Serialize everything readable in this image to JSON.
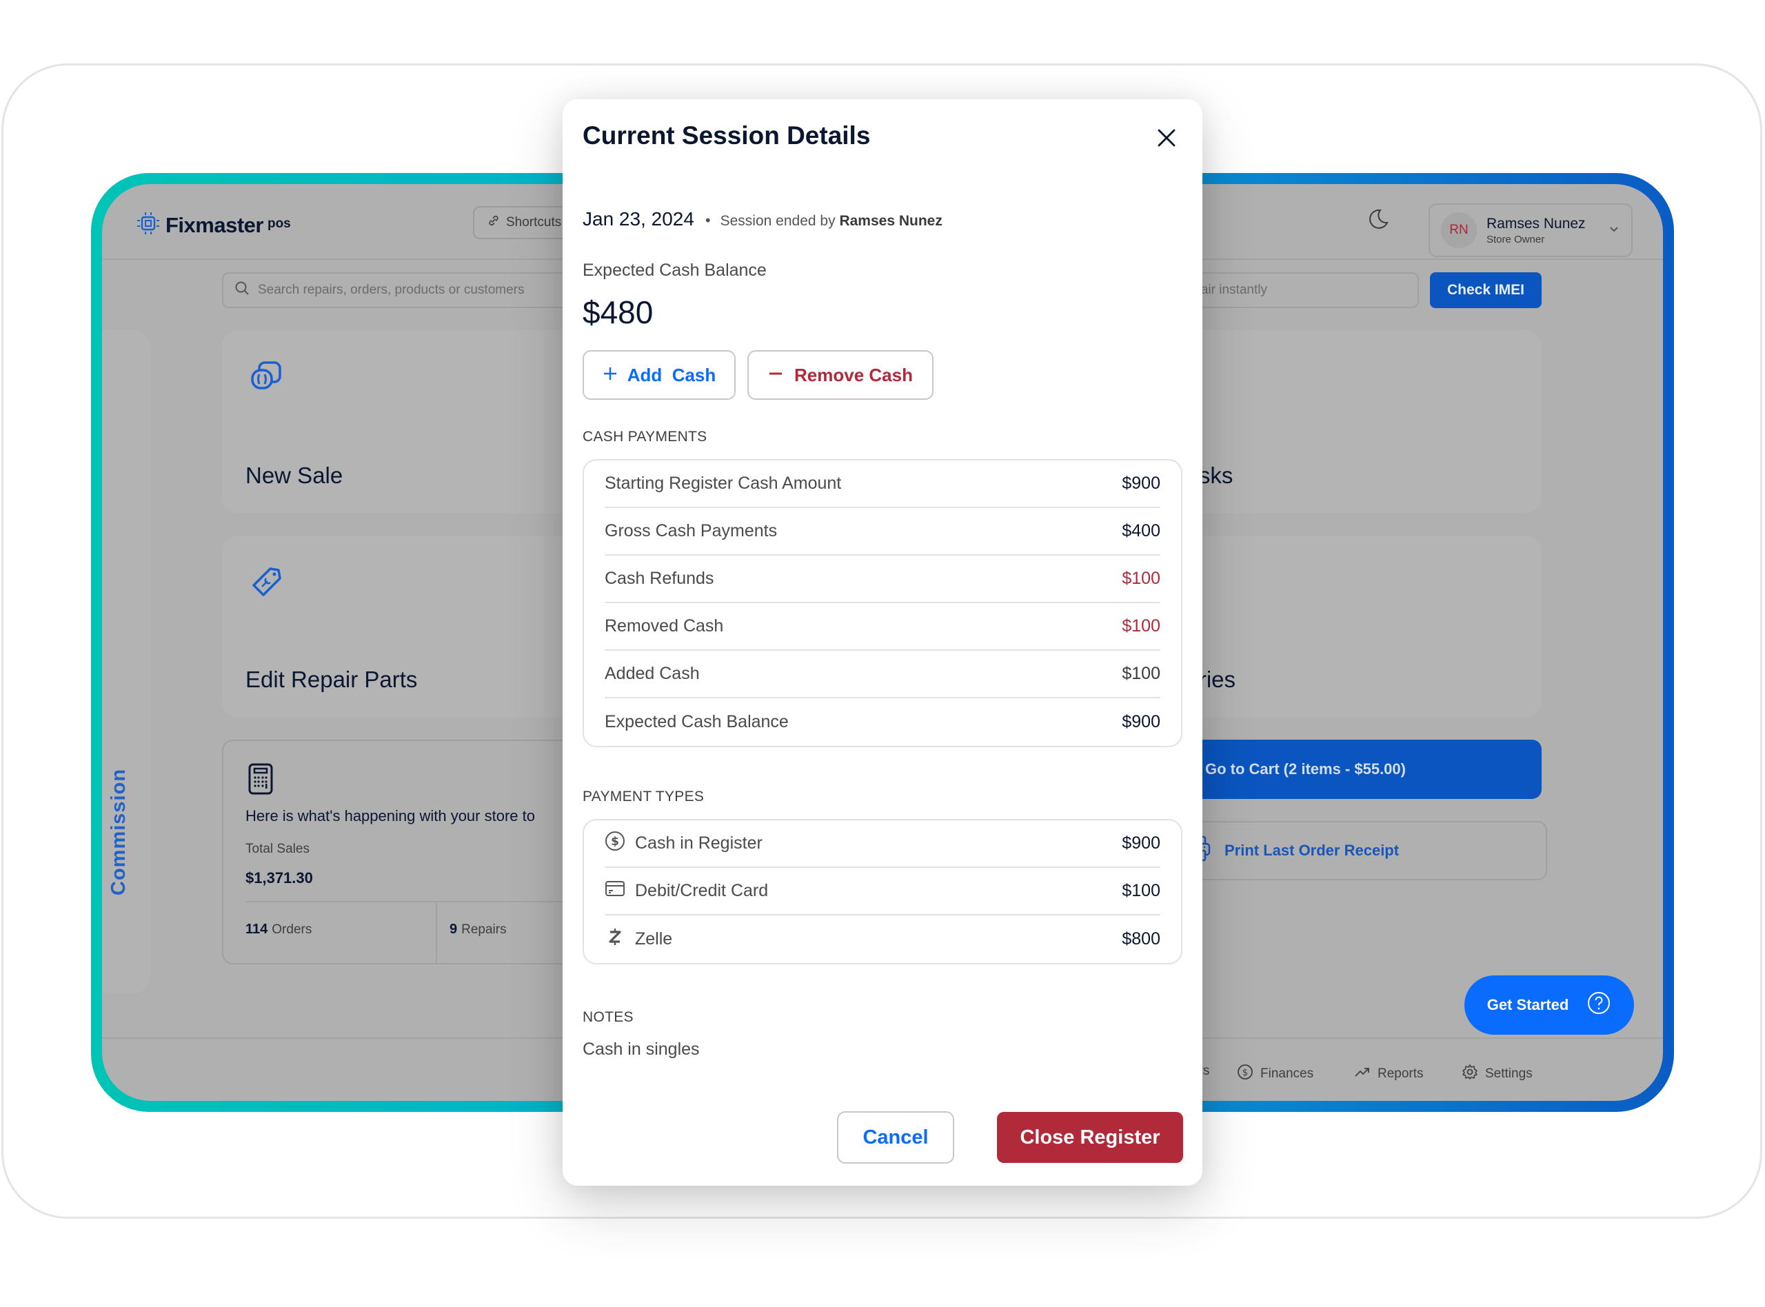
{
  "app": {
    "logo_text": "Fixmaster",
    "logo_suffix": "pos",
    "shortcuts_label": "Shortcuts",
    "user": {
      "initials": "RN",
      "name": "Ramses Nunez",
      "role": "Store Owner"
    },
    "search_placeholder": "Search repairs, orders, products or customers",
    "imei_placeholder": "f a repair instantly",
    "check_imei_label": "Check IMEI",
    "sidebar_tab_label": "Commission",
    "cards": {
      "new_sale": "New Sale",
      "edit_repair_parts": "Edit Repair Parts",
      "tasks": "Tasks",
      "accessories": "sories"
    },
    "stats": {
      "headline": "Here is what's happening with your store to",
      "total_sales_label": "Total Sales",
      "total_sales_value": "$1,371.30",
      "orders_count": "114",
      "orders_label": "Orders",
      "repairs_count": "9",
      "repairs_label": "Repairs"
    },
    "cart_button": "Go to Cart (2 items - $55.00)",
    "print_button": "Print Last Order Receipt",
    "get_started_button": "Get Started",
    "bottom_nav": [
      {
        "label": "ers",
        "icon": "users-icon"
      },
      {
        "label": "Finances",
        "icon": "dollar-circle-icon"
      },
      {
        "label": "Reports",
        "icon": "trend-up-icon"
      },
      {
        "label": "Settings",
        "icon": "gear-icon"
      }
    ]
  },
  "modal": {
    "title": "Current Session Details",
    "date": "Jan 23, 2024",
    "session_ended_prefix": "Session ended by",
    "session_ended_by": "Ramses Nunez",
    "expected_cash_balance_label": "Expected Cash Balance",
    "expected_cash_balance_value": "$480",
    "add_cash_label": "Add  Cash",
    "remove_cash_label": "Remove Cash",
    "cash_payments": {
      "label": "CASH PAYMENTS",
      "rows": [
        {
          "label": "Starting Register Cash Amount",
          "value": "$900",
          "tone": "normal"
        },
        {
          "label": "Gross Cash Payments",
          "value": "$400",
          "tone": "normal"
        },
        {
          "label": "Cash Refunds",
          "value": "$100",
          "tone": "negative"
        },
        {
          "label": "Removed Cash",
          "value": "$100",
          "tone": "negative"
        },
        {
          "label": "Added Cash",
          "value": "$100",
          "tone": "light"
        },
        {
          "label": "Expected Cash Balance",
          "value": "$900",
          "tone": "normal"
        }
      ]
    },
    "payment_types": {
      "label": "PAYMENT TYPES",
      "rows": [
        {
          "label": "Cash in Register",
          "value": "$900",
          "icon": "dollar-circle-icon"
        },
        {
          "label": "Debit/Credit Card",
          "value": "$100",
          "icon": "credit-card-icon"
        },
        {
          "label": "Zelle",
          "value": "$800",
          "icon": "zelle-icon"
        }
      ]
    },
    "notes": {
      "label": "NOTES",
      "text": "Cash in singles"
    },
    "cancel_label": "Cancel",
    "close_register_label": "Close Register"
  },
  "colors": {
    "primary_blue": "#0a6cff",
    "danger_red": "#b02a3a",
    "brand_teal": "#00c4b6",
    "brand_blue": "#0a55c0"
  }
}
